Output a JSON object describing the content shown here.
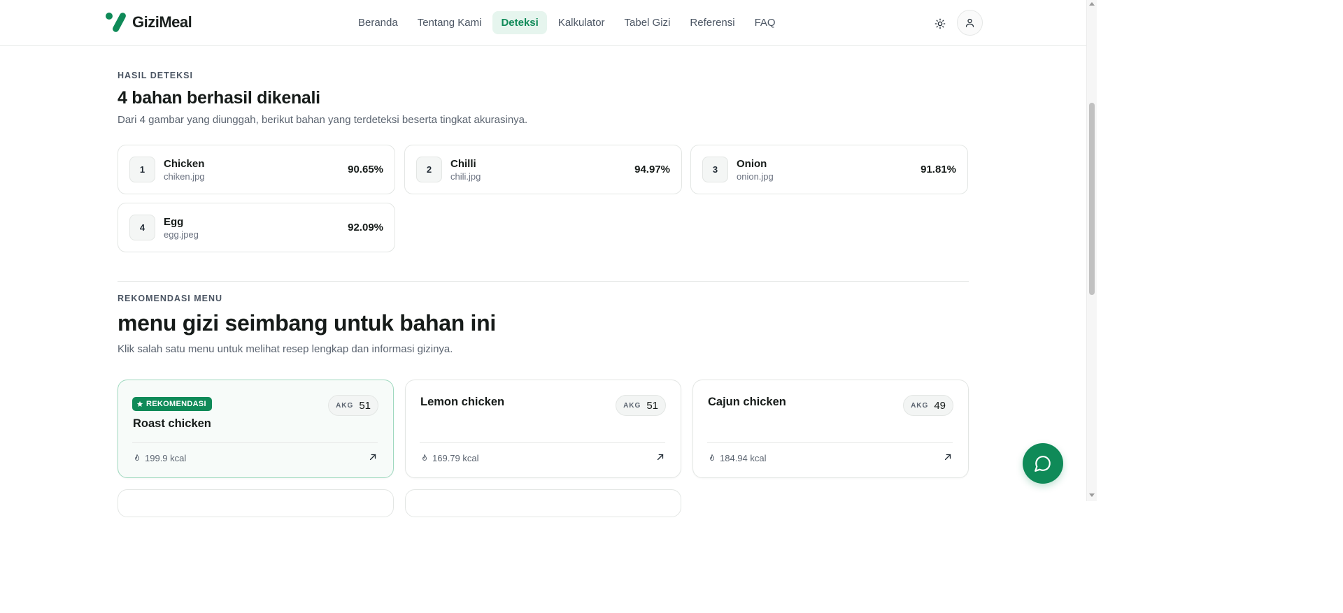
{
  "brand": {
    "name": "GiziMeal"
  },
  "nav": [
    {
      "label": "Beranda",
      "active": false
    },
    {
      "label": "Tentang Kami",
      "active": false
    },
    {
      "label": "Deteksi",
      "active": true
    },
    {
      "label": "Kalkulator",
      "active": false
    },
    {
      "label": "Tabel Gizi",
      "active": false
    },
    {
      "label": "Referensi",
      "active": false
    },
    {
      "label": "FAQ",
      "active": false
    }
  ],
  "detection": {
    "eyebrow": "HASIL DETEKSI",
    "title": "4 bahan berhasil dikenali",
    "subtitle": "Dari 4 gambar yang diunggah, berikut bahan yang terdeteksi beserta tingkat akurasinya.",
    "items": [
      {
        "num": "1",
        "name": "Chicken",
        "file": "chiken.jpg",
        "accuracy": "90.65%"
      },
      {
        "num": "2",
        "name": "Chilli",
        "file": "chili.jpg",
        "accuracy": "94.97%"
      },
      {
        "num": "3",
        "name": "Onion",
        "file": "onion.jpg",
        "accuracy": "91.81%"
      },
      {
        "num": "4",
        "name": "Egg",
        "file": "egg.jpeg",
        "accuracy": "92.09%"
      }
    ]
  },
  "recommendation": {
    "eyebrow": "REKOMENDASI MENU",
    "title": "menu gizi seimbang untuk bahan ini",
    "subtitle": "Klik salah satu menu untuk melihat resep lengkap dan informasi gizinya.",
    "badge": "REKOMENDASI",
    "akg_label": "AKG",
    "menus": [
      {
        "name": "Roast chicken",
        "akg": "51",
        "kcal": "199.9 kcal",
        "featured": true
      },
      {
        "name": "Lemon chicken",
        "akg": "51",
        "kcal": "169.79 kcal",
        "featured": false
      },
      {
        "name": "Cajun chicken",
        "akg": "49",
        "kcal": "184.94 kcal",
        "featured": false
      }
    ]
  },
  "colors": {
    "accent": "#0f8a58",
    "accent_soft": "#e6f5ee"
  },
  "icons": {
    "theme": "sun-icon",
    "user": "user-icon",
    "chat": "chat-bubble-icon",
    "flame": "flame-icon",
    "arrow": "arrow-up-right-icon",
    "star": "star-icon"
  }
}
